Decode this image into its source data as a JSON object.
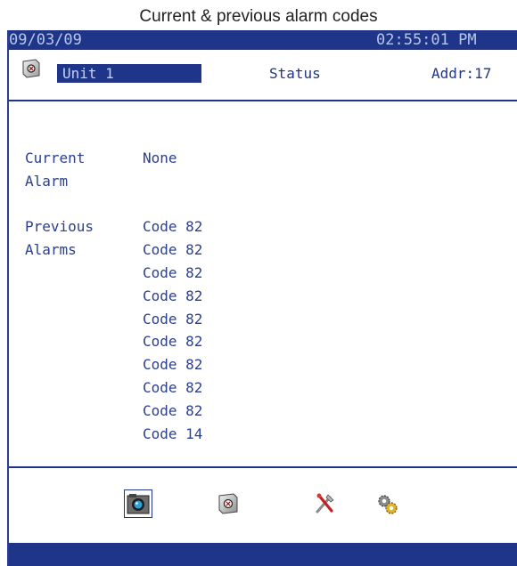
{
  "caption": "Current & previous alarm codes",
  "titlebar": {
    "date": "09/03/09",
    "time": "02:55:01 PM"
  },
  "header": {
    "unit": "Unit 1",
    "status": "Status",
    "addr": "Addr:17"
  },
  "alarms": {
    "current_label_1": "Current",
    "current_label_2": "Alarm",
    "current_value": "None",
    "previous_label_1": "Previous",
    "previous_label_2": "Alarms",
    "previous_codes": [
      "Code 82",
      "Code 82",
      "Code 82",
      "Code 82",
      "Code 82",
      "Code 82",
      "Code 82",
      "Code 82",
      "Code 82",
      "Code 14"
    ]
  },
  "toolbar": {
    "icons": [
      "camera-icon",
      "unit-icon",
      "tools-icon",
      "gears-icon"
    ],
    "selected": "camera-icon"
  },
  "colors": {
    "primary": "#1f3589",
    "text": "#2a3f8f",
    "titlebar_text": "#b9c6e8"
  }
}
